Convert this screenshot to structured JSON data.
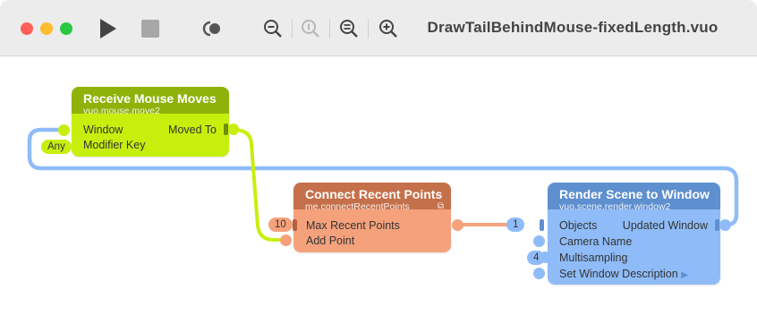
{
  "toolbar": {
    "title": "DrawTailBehindMouse-fixedLength.vuo",
    "icons": [
      "play-icon",
      "stop-icon",
      "show-events-icon",
      "zoom-out-icon",
      "zoom-actual-icon",
      "zoom-to-fit-icon",
      "zoom-in-icon"
    ]
  },
  "nodes": {
    "mouse": {
      "title": "Receive Mouse Moves",
      "class_name": "vuo.mouse.move2",
      "inputs": [
        "Window",
        "Modifier Key"
      ],
      "outputs": [
        "Moved To"
      ],
      "constants": {
        "modifier_key": "Any"
      },
      "colors": {
        "header": "#8fb20a",
        "body": "#c7ef0e"
      }
    },
    "connect": {
      "title": "Connect Recent Points",
      "class_name": "me.connectRecentPoints",
      "inputs": [
        "Max Recent Points",
        "Add Point"
      ],
      "constants": {
        "max_recent_points": "10"
      },
      "colors": {
        "header": "#c4704a",
        "body": "#f5a27c"
      }
    },
    "render": {
      "title": "Render Scene to Window",
      "class_name": "vuo.scene.render.window2",
      "inputs": [
        "Objects",
        "Camera Name",
        "Multisampling",
        "Set Window Description"
      ],
      "outputs": [
        "Updated Window"
      ],
      "constants": {
        "objects": "1",
        "multisampling": "4"
      },
      "colors": {
        "header": "#5e8fcf",
        "body": "#8fbcf8"
      }
    }
  }
}
